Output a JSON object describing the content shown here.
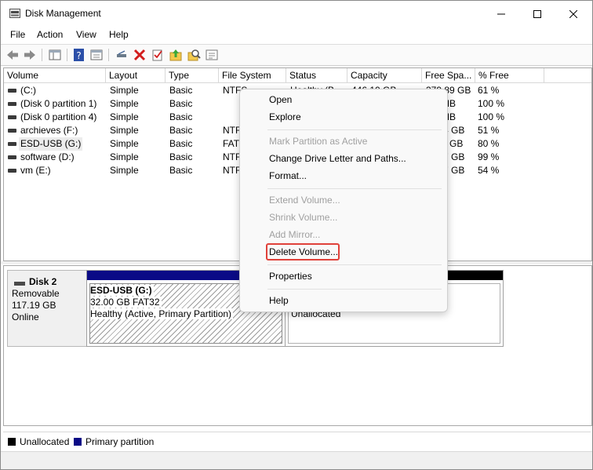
{
  "window": {
    "title": "Disk Management"
  },
  "menubar": {
    "items": [
      "File",
      "Action",
      "View",
      "Help"
    ]
  },
  "toolbar": {
    "icons": [
      "back-icon",
      "forward-icon",
      "console-tree-icon",
      "help-icon",
      "properties-icon",
      "connect-icon",
      "delete-icon",
      "check-icon",
      "folder-up-icon",
      "search-icon",
      "settings-icon"
    ]
  },
  "volume_list": {
    "columns": [
      "Volume",
      "Layout",
      "Type",
      "File System",
      "Status",
      "Capacity",
      "Free Spa...",
      "% Free"
    ],
    "rows": [
      {
        "volume": "(C:)",
        "layout": "Simple",
        "type": "Basic",
        "fs": "NTFS",
        "status": "Healthy (B...",
        "capacity": "446.10 GB",
        "free": "379.89 GB",
        "pct": "61 %"
      },
      {
        "volume": "(Disk 0 partition 1)",
        "layout": "Simple",
        "type": "Basic",
        "fs": "",
        "status": "",
        "capacity": "",
        "free": "MB",
        "pct": "100 %"
      },
      {
        "volume": "(Disk 0 partition 4)",
        "layout": "Simple",
        "type": "Basic",
        "fs": "",
        "status": "",
        "capacity": "",
        "free": "MB",
        "pct": "100 %"
      },
      {
        "volume": "archieves (F:)",
        "layout": "Simple",
        "type": "Basic",
        "fs": "NTF",
        "status": "",
        "capacity": "",
        "free": "4 GB",
        "pct": "51 %"
      },
      {
        "volume": "ESD-USB (G:)",
        "layout": "Simple",
        "type": "Basic",
        "fs": "FAT",
        "status": "",
        "capacity": "",
        "free": "GB",
        "pct": "80 %"
      },
      {
        "volume": "software (D:)",
        "layout": "Simple",
        "type": "Basic",
        "fs": "NTF",
        "status": "",
        "capacity": "",
        "free": "7 GB",
        "pct": "99 %"
      },
      {
        "volume": "vm (E:)",
        "layout": "Simple",
        "type": "Basic",
        "fs": "NTF",
        "status": "",
        "capacity": "",
        "free": "7 GB",
        "pct": "54 %"
      }
    ]
  },
  "disk": {
    "name": "Disk 2",
    "kind": "Removable",
    "size": "117.19 GB",
    "state": "Online",
    "partition": {
      "name": "ESD-USB  (G:)",
      "size_fs": "32.00 GB FAT32",
      "health": "Healthy (Active, Primary Partition)"
    },
    "unallocated_label": "Unallocated"
  },
  "legend": {
    "unallocated": "Unallocated",
    "primary": "Primary partition",
    "unallocated_color": "#000000",
    "primary_color": "#0a0a86"
  },
  "context_menu": {
    "open": "Open",
    "explore": "Explore",
    "mark_active": "Mark Partition as Active",
    "change_letter": "Change Drive Letter and Paths...",
    "format": "Format...",
    "extend": "Extend Volume...",
    "shrink": "Shrink Volume...",
    "add_mirror": "Add Mirror...",
    "delete": "Delete Volume...",
    "properties": "Properties",
    "help": "Help",
    "highlight_color": "#e0413a"
  }
}
